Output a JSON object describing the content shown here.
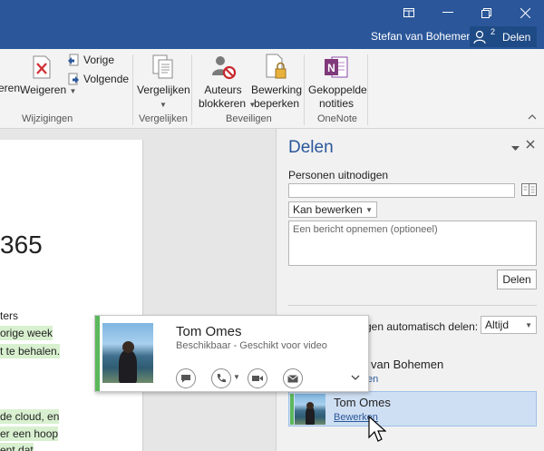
{
  "titlebar": {
    "user_name": "Stefan van Bohemen",
    "share_label": "Delen",
    "share_badge": "2"
  },
  "ribbon": {
    "changes": {
      "accept_fragment": "eren",
      "reject_label": "Weigeren",
      "previous_label": "Vorige",
      "next_label": "Volgende",
      "group_label": "Wijzigingen"
    },
    "compare": {
      "compare_label": "Vergelijken",
      "group_label": "Vergelijken"
    },
    "protect": {
      "block_authors_line1": "Auteurs",
      "block_authors_line2": "blokkeren",
      "restrict_editing_line1": "Bewerking",
      "restrict_editing_line2": "beperken",
      "group_label": "Beveiligen"
    },
    "onenote": {
      "linked_notes_line1": "Gekoppelde",
      "linked_notes_line2": "notities",
      "group_label": "OneNote"
    }
  },
  "document": {
    "heading": "365",
    "lines": [
      {
        "text": "ters",
        "highlight": false
      },
      {
        "text": "orige week",
        "highlight": true
      },
      {
        "text": "t te behalen.",
        "highlight": true
      },
      {
        "text": "de cloud, en",
        "highlight": true
      },
      {
        "text": "er een hoop",
        "highlight": true
      },
      {
        "text": "ent dat",
        "highlight": true
      },
      {
        "text": "",
        "highlight": true
      }
    ]
  },
  "share_pane": {
    "title": "Delen",
    "invite_label": "Personen uitnodigen",
    "invite_value": "",
    "permission_value": "Kan bewerken",
    "message_placeholder": "Een bericht opnemen (optioneel)",
    "share_button": "Delen",
    "auto_share_label": "gen automatisch delen:",
    "auto_share_value": "Altijd",
    "people": [
      {
        "name": "van Bohemen",
        "permission": "en"
      },
      {
        "name": "Tom Omes",
        "permission": "Bewerken"
      }
    ]
  },
  "contact_card": {
    "name": "Tom Omes",
    "status": "Beschikbaar - Geschikt voor video"
  },
  "colors": {
    "accent": "#2b579a",
    "presence_available": "#5bb85c",
    "highlight": "#d8f0cf"
  }
}
